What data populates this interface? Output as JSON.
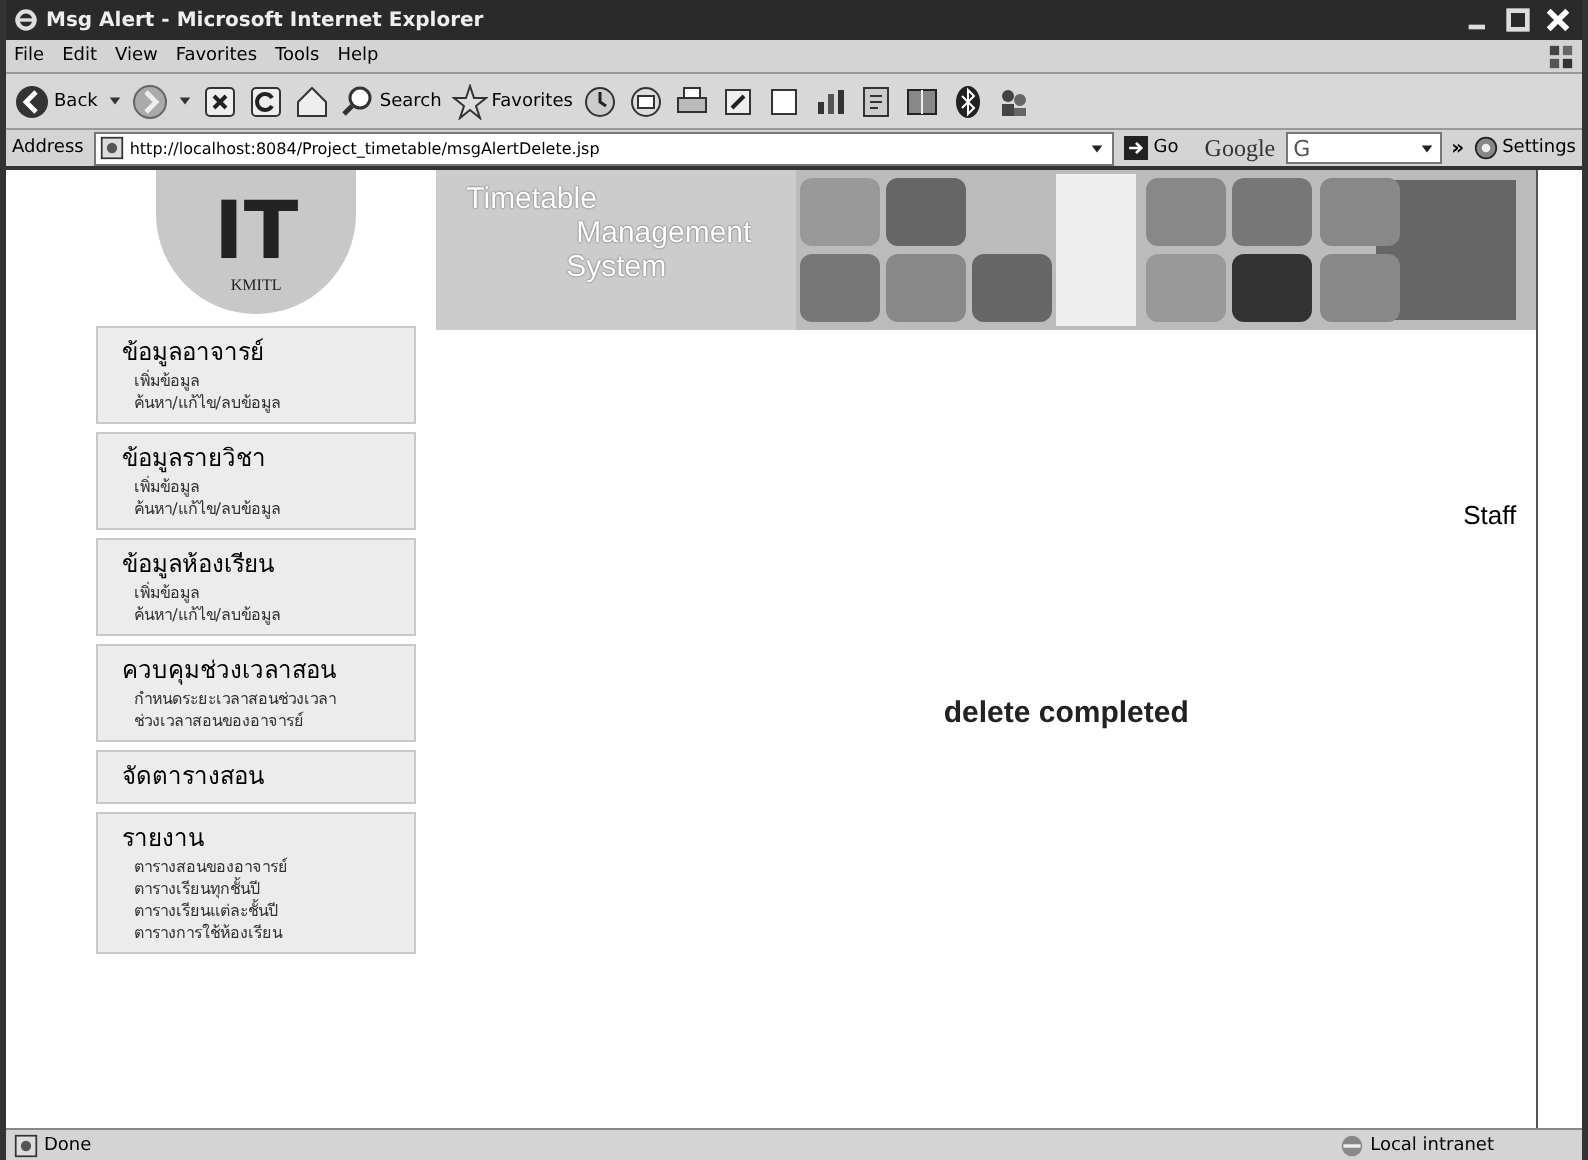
{
  "window": {
    "title": "Msg Alert - Microsoft Internet Explorer"
  },
  "menu_bar": [
    "File",
    "Edit",
    "View",
    "Favorites",
    "Tools",
    "Help"
  ],
  "toolbar": {
    "back": "Back",
    "search": "Search",
    "favorites": "Favorites"
  },
  "address_bar": {
    "label": "Address",
    "url": "http://localhost:8084/Project_timetable/msgAlertDelete.jsp",
    "go": "Go",
    "google": "Google",
    "google_button": "G",
    "chevron": "»",
    "settings": "Settings"
  },
  "logo": {
    "mark": "IT",
    "text": "KMITL"
  },
  "banner": {
    "lines": [
      "Timetable",
      "Management",
      "System"
    ]
  },
  "sidebar": [
    {
      "title": "ข้อมูลอาจารย์",
      "items": [
        "เพิ่มข้อมูล",
        "ค้นหา/แก้ไข/ลบข้อมูล"
      ]
    },
    {
      "title": "ข้อมูลรายวิชา",
      "items": [
        "เพิ่มข้อมูล",
        "ค้นหา/แก้ไข/ลบข้อมูล"
      ]
    },
    {
      "title": "ข้อมูลห้องเรียน",
      "items": [
        "เพิ่มข้อมูล",
        "ค้นหา/แก้ไข/ลบข้อมูล"
      ]
    },
    {
      "title": "ควบคุมช่วงเวลาสอน",
      "items": [
        "กำหนดระยะเวลาสอนช่วงเวลา",
        "ช่วงเวลาสอนของอาจารย์"
      ]
    },
    {
      "title": "จัดตารางสอน"
    },
    {
      "title": "รายงาน",
      "items": [
        "ตารางสอนของอาจารย์",
        "ตารางเรียนทุกชั้นปี",
        "ตารางเรียนแต่ละชั้นปี",
        "ตารางการใช้ห้องเรียน"
      ]
    }
  ],
  "page": {
    "user": "Staff",
    "message": "delete completed"
  },
  "status_bar": {
    "left": "Done",
    "right": "Local intranet"
  }
}
